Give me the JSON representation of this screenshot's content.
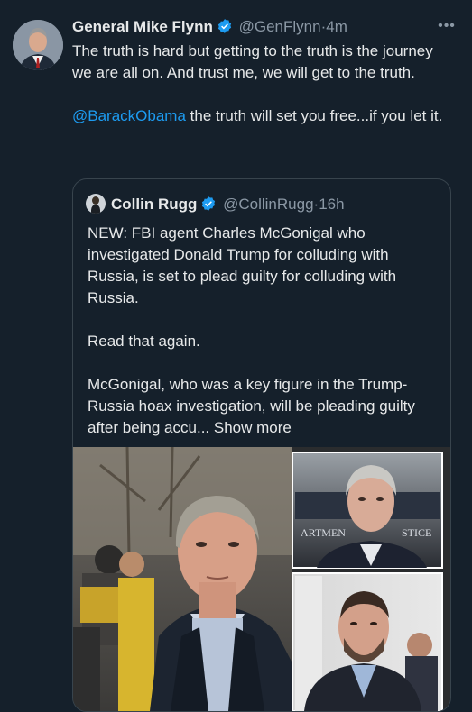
{
  "tweet": {
    "author_name": "General Mike Flynn",
    "author_handle": "@GenFlynn",
    "separator": "·",
    "time": "4m",
    "more_icon": "ellipsis-icon",
    "line1": "The truth is hard but getting to the truth is the journey we are all on. And trust me, we will get to the truth.",
    "mention": "@BarackObama",
    "line2_rest": " the truth will set you free...if you let it."
  },
  "quote": {
    "author_name": "Collin Rugg",
    "author_handle": "@CollinRugg",
    "separator": "·",
    "time": "16h",
    "para1": "NEW: FBI agent Charles McGonigal who investigated Donald Trump for colluding with Russia, is set to plead guilty for colluding with Russia.",
    "para2": "Read that again.",
    "para3": "McGonigal, who was a key figure in the Trump-Russia hoax investigation, will be pleading guilty after being accu...",
    "show_more": "Show more",
    "media_sign_left": "ARTMEN",
    "media_sign_right": "STICE"
  },
  "colors": {
    "background": "#15202b",
    "text": "#e7e9ea",
    "muted": "#8b98a5",
    "link": "#1d9bf0",
    "border": "#38444d",
    "verified": "#1d9bf0"
  }
}
